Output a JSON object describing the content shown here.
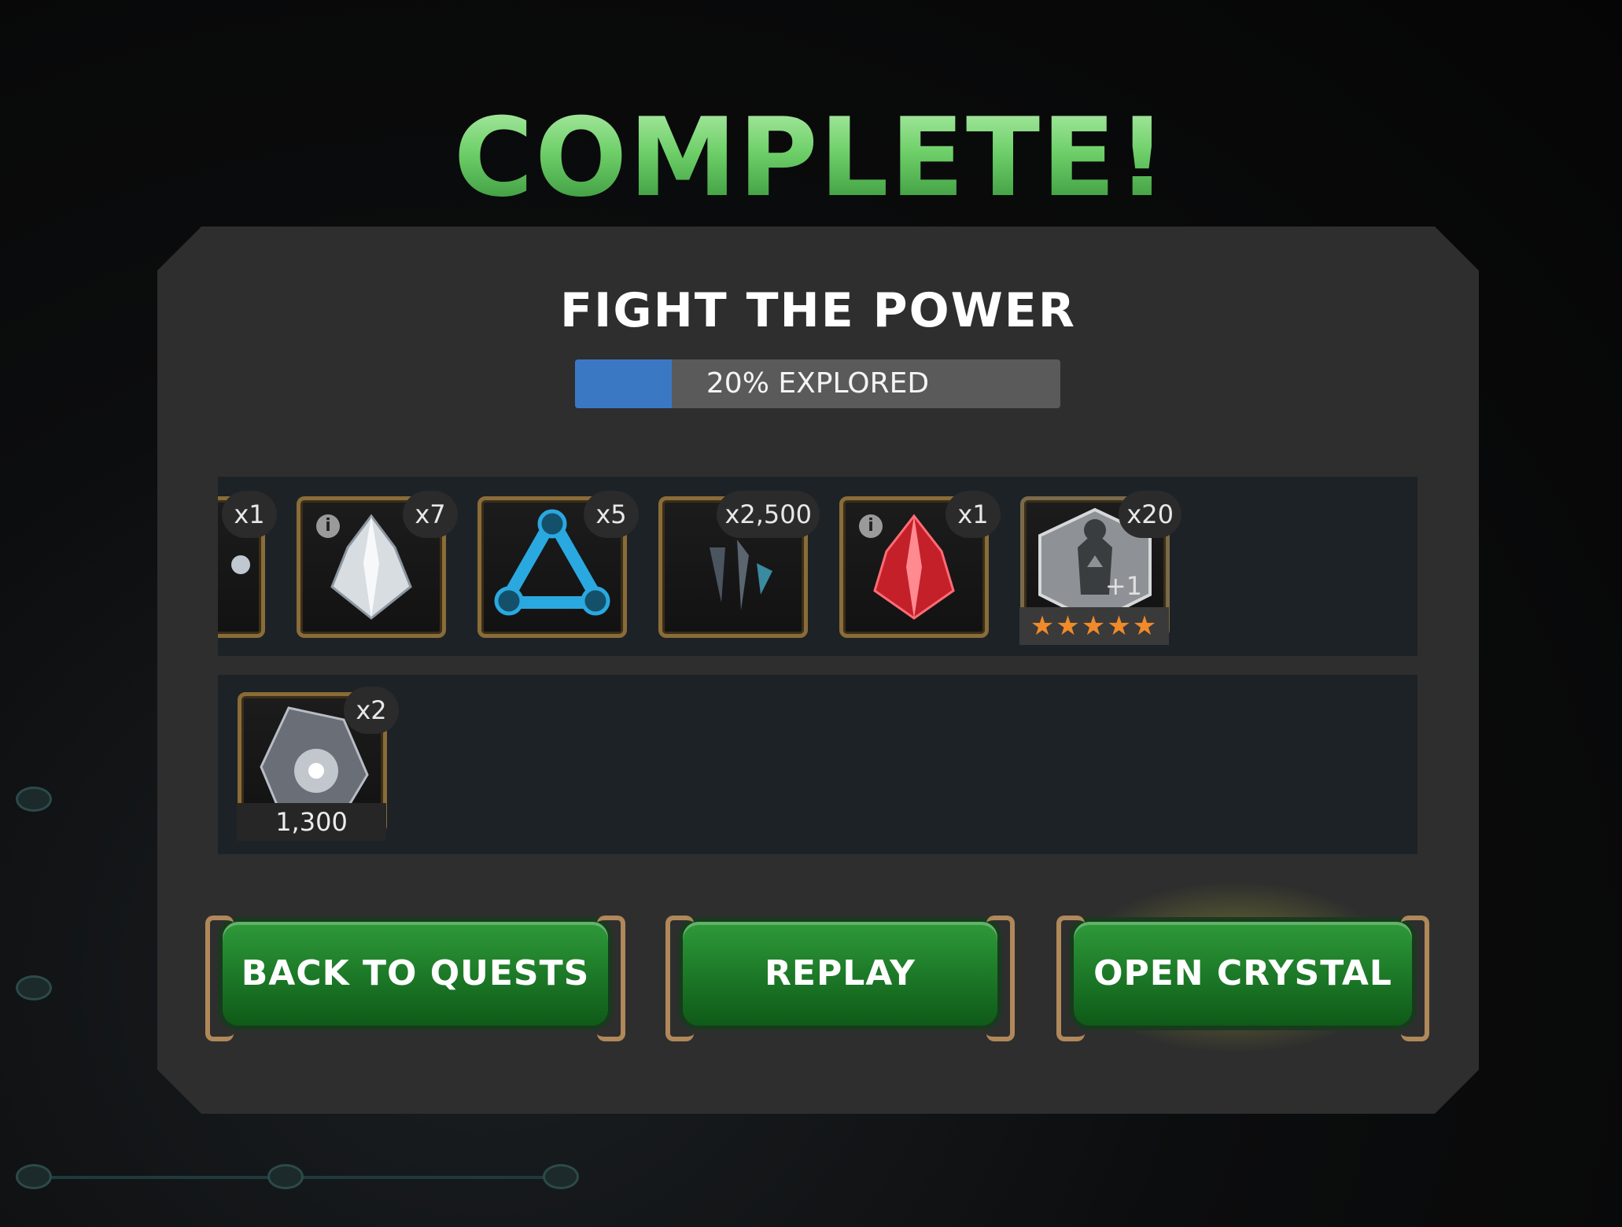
{
  "header": {
    "title": "COMPLETE!"
  },
  "quest": {
    "name": "FIGHT THE POWER",
    "progress_label": "20% EXPLORED",
    "progress_fraction": 0.2,
    "progress_color": "#3b78c4"
  },
  "rewards_row1": [
    {
      "icon": "orb-icon",
      "count": "x1",
      "info": false
    },
    {
      "icon": "crystal-shard-icon",
      "count": "x7",
      "info": true
    },
    {
      "icon": "catalyst-icon",
      "count": "x5",
      "info": false
    },
    {
      "icon": "shard-icon",
      "count": "x2,500",
      "info": false
    },
    {
      "icon": "red-crystal-icon",
      "count": "x1",
      "info": true
    },
    {
      "icon": "champion-token-icon",
      "count": "x20",
      "info": false,
      "badge": "+1",
      "stars": "★★★★★"
    }
  ],
  "rewards_row2": [
    {
      "icon": "stone-icon",
      "count": "x2",
      "sub": "1,300"
    }
  ],
  "buttons": {
    "back": "BACK TO QUESTS",
    "replay": "REPLAY",
    "open": "OPEN CRYSTAL"
  },
  "colors": {
    "title_green": "#6fd06a",
    "button_green": "#1d7a28",
    "panel": "#2e2e2e",
    "item_frame": "#8a6c38"
  }
}
